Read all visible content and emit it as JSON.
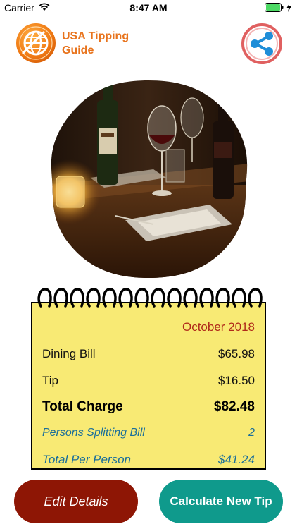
{
  "status_bar": {
    "carrier": "Carrier",
    "time": "8:47 AM"
  },
  "header": {
    "title": "USA Tipping\nGuide",
    "logo_icon": "globe-icon",
    "share_icon": "share-icon"
  },
  "photo": {
    "description_icon": "restaurant-table-photo"
  },
  "notepad": {
    "date": "October 2018",
    "dining_bill_label": "Dining Bill",
    "dining_bill_value": "$65.98",
    "tip_label": "Tip",
    "tip_value": "$16.50",
    "total_charge_label": "Total Charge",
    "total_charge_value": "$82.48",
    "persons_label": "Persons Splitting Bill",
    "persons_value": "2",
    "per_person_label": "Total Per Person",
    "per_person_value": "$41.24"
  },
  "buttons": {
    "edit_label": "Edit Details",
    "calculate_label": "Calculate New Tip"
  },
  "colors": {
    "brand_orange": "#e8731c",
    "notepad_yellow": "#f8ea74",
    "edit_button": "#8e1605",
    "calculate_button": "#0f9a8c",
    "share_ring": "#e06060",
    "share_glyph": "#1f8ed8"
  }
}
